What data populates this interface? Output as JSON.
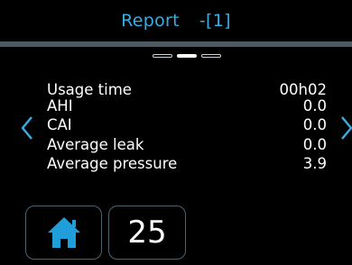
{
  "header": {
    "title": "Report",
    "index": "-[1]"
  },
  "pager": {
    "count": 3,
    "active": 2
  },
  "report_rows": [
    {
      "label": "Usage time",
      "value": "00h02"
    },
    {
      "label": "AHI",
      "value": "0.0"
    },
    {
      "label": "CAI",
      "value": "0.0"
    },
    {
      "label": "Average leak",
      "value": "0.0"
    },
    {
      "label": "Average pressure",
      "value": "3.9"
    }
  ],
  "nav": {
    "prev_icon": "chevron-left-icon",
    "next_icon": "chevron-right-icon"
  },
  "footer": {
    "home_icon": "home-icon",
    "number_value": "25"
  },
  "colors": {
    "accent": "#36aee6",
    "background": "#000000",
    "divider": "#4c5a66",
    "button_border": "#4f6270"
  }
}
